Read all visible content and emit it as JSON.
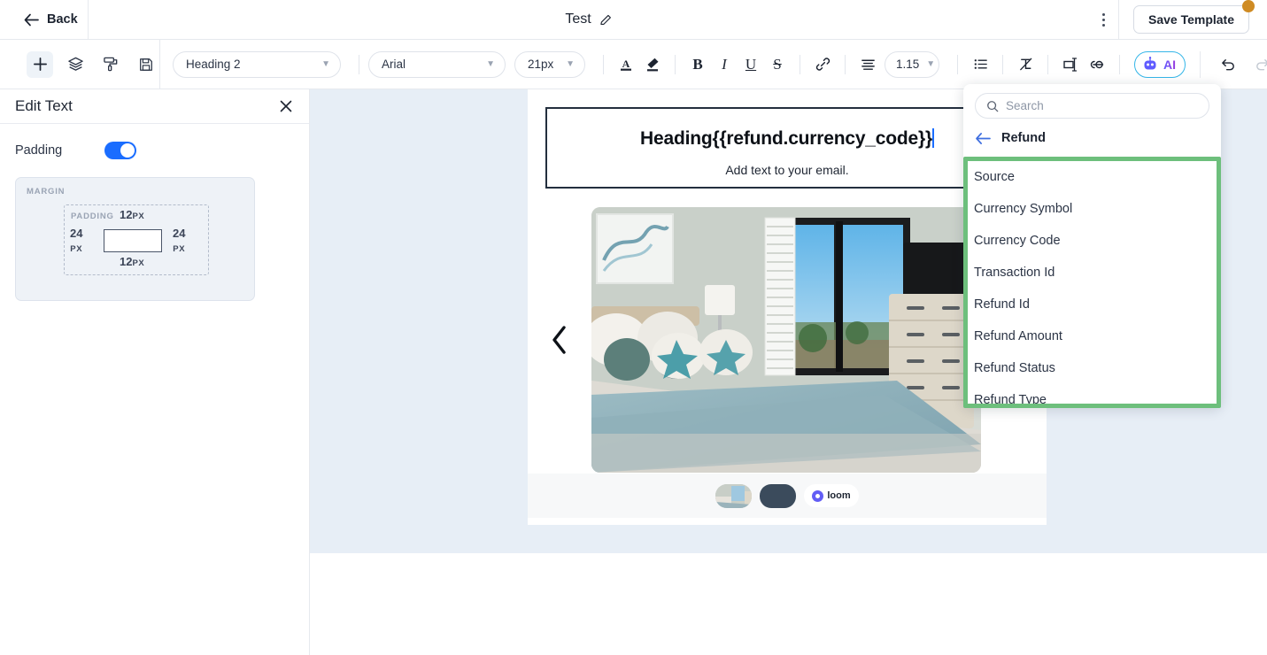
{
  "topbar": {
    "back_label": "Back",
    "title": "Test",
    "edit_icon": "pencil-icon",
    "kebab_icon": "more-vertical-icon",
    "save_label": "Save Template",
    "badge_color": "#cf8b23"
  },
  "toolbar": {
    "left_icons": [
      {
        "name": "add-block-icon",
        "glyph": "+"
      },
      {
        "name": "layers-icon",
        "glyph": "layers"
      },
      {
        "name": "paint-roller-icon",
        "glyph": "roller"
      },
      {
        "name": "save-disk-icon",
        "glyph": "disk"
      }
    ],
    "style_select": "Heading 2",
    "font_select": "Arial",
    "size_select": "21px",
    "line_height_select": "1.15",
    "text_color_icon": "text-color-icon",
    "highlight_icon": "highlighter-icon",
    "bold_label": "B",
    "italic_label": "I",
    "underline_label": "U",
    "strike_label": "S",
    "link_icon": "link-icon",
    "align_icon": "align-center-icon",
    "bullet_icon": "bulleted-list-icon",
    "clear_format_icon": "clear-formatting-icon",
    "merge_tag_icon": "merge-tag-icon",
    "variable_link_icon": "variable-link-icon",
    "ai_label": "AI",
    "ai_icon": "robot-icon",
    "ai_border_color": "#35b6e8",
    "undo_icon": "undo-icon",
    "redo_icon": "redo-icon"
  },
  "left_panel": {
    "title": "Edit Text",
    "close_icon": "close-icon",
    "padding_label": "Padding",
    "padding_enabled": true,
    "toggle_color": "#1a6dff",
    "box_model": {
      "margin_label": "MARGIN",
      "padding_label": "PADDING",
      "top_value": "12",
      "top_unit": "PX",
      "bottom_value": "12",
      "bottom_unit": "PX",
      "left_value": "24",
      "left_unit": "PX",
      "right_value": "24",
      "right_unit": "PX"
    }
  },
  "canvas": {
    "background_color": "#e7eef6",
    "selected_block_border": "#232f3e",
    "heading_text": "Heading{{refund.currency_code}}",
    "sub_text": "Add text to your email.",
    "prev_arrow_icon": "chevron-left-icon",
    "image_alt": "coastal-bedroom-photo",
    "loom_badge_label": "loom",
    "loom_gear_icon": "loom-logo-icon"
  },
  "variable_dropdown": {
    "search_placeholder": "Search",
    "search_value": "",
    "search_icon": "search-icon",
    "back_icon": "arrow-left-icon",
    "breadcrumb": "Refund",
    "highlight_border_color": "#6dbf7c",
    "items": [
      {
        "label": "Source"
      },
      {
        "label": "Currency Symbol"
      },
      {
        "label": "Currency Code"
      },
      {
        "label": "Transaction Id"
      },
      {
        "label": "Refund Id"
      },
      {
        "label": "Refund Amount"
      },
      {
        "label": "Refund Status"
      },
      {
        "label": "Refund Type"
      }
    ]
  }
}
